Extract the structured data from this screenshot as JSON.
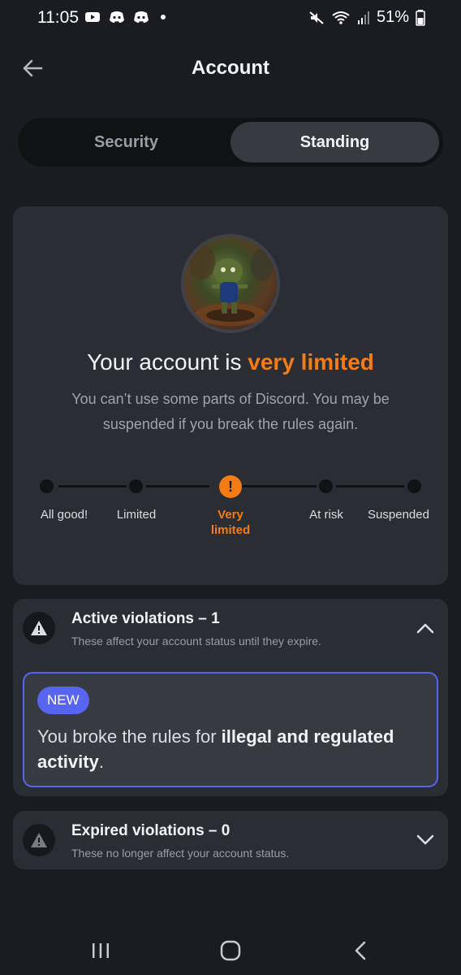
{
  "status_bar": {
    "time": "11:05",
    "battery": "51%",
    "icons_left": [
      "youtube-icon",
      "discord-icon",
      "discord-icon"
    ],
    "icons_right": [
      "mute-icon",
      "wifi-icon",
      "signal-icon",
      "battery-icon"
    ]
  },
  "header": {
    "title": "Account"
  },
  "tabs": [
    {
      "label": "Security",
      "active": false
    },
    {
      "label": "Standing",
      "active": true
    }
  ],
  "standing": {
    "headline_prefix": "Your account is ",
    "headline_status": "very limited",
    "description": "You can’t use some parts of Discord. You may be suspended if you break the rules again.",
    "levels": [
      "All good!",
      "Limited",
      "Very limited",
      "At risk",
      "Suspended"
    ],
    "current_level_index": 2,
    "accent_color": "#f57c14"
  },
  "active_violations": {
    "title": "Active violations – 1",
    "subtitle": "These affect your account status until they expire.",
    "expanded": true,
    "items": [
      {
        "badge": "NEW",
        "text_prefix": "You broke the rules for ",
        "text_bold": "illegal and regulated activity",
        "text_suffix": "."
      }
    ]
  },
  "expired_violations": {
    "title": "Expired violations – 0",
    "subtitle": "These no longer affect your account status.",
    "expanded": false
  },
  "colors": {
    "background": "#1b1c21",
    "card": "#2b2d34",
    "blurple": "#5865f2"
  }
}
